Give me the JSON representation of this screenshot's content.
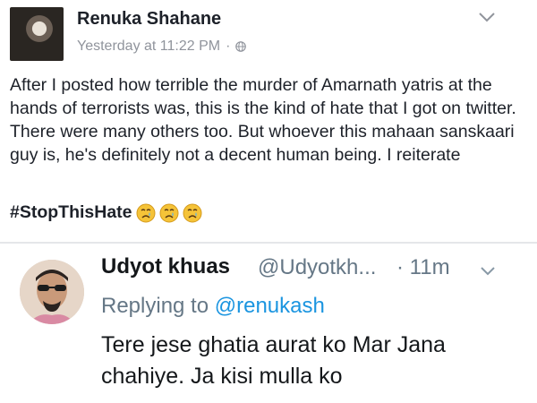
{
  "post": {
    "author": "Renuka Shahane",
    "timestamp": "Yesterday at 11:22 PM",
    "separator": "·",
    "privacy_icon": "globe-icon",
    "menu_icon": "chevron-down-icon",
    "body": "After I posted how terrible the murder of Amarnath yatris at the hands of terrorists was, this is the kind of hate that I got on twitter. There were many others too. But whoever this mahaan sanskaari guy is, he's definitely not a decent human being. I reiterate",
    "hashtag": "#StopThisHate",
    "emojis": [
      "crying-face-emoji",
      "crying-face-emoji",
      "crying-face-emoji"
    ]
  },
  "tweet": {
    "name": "Udyot khuas",
    "handle": "@Udyotkh...",
    "separator_time": "· 11m",
    "menu_icon": "chevron-down-icon",
    "reply_prefix": "Replying to ",
    "reply_mention": "@renukash",
    "text": "Tere jese ghatia aurat ko Mar Jana chahiye. Ja kisi mulla ko"
  },
  "colors": {
    "fb_meta": "#90949c",
    "tw_secondary": "#657786",
    "tw_link": "#1b95e0",
    "divider": "#e5e6e9"
  }
}
